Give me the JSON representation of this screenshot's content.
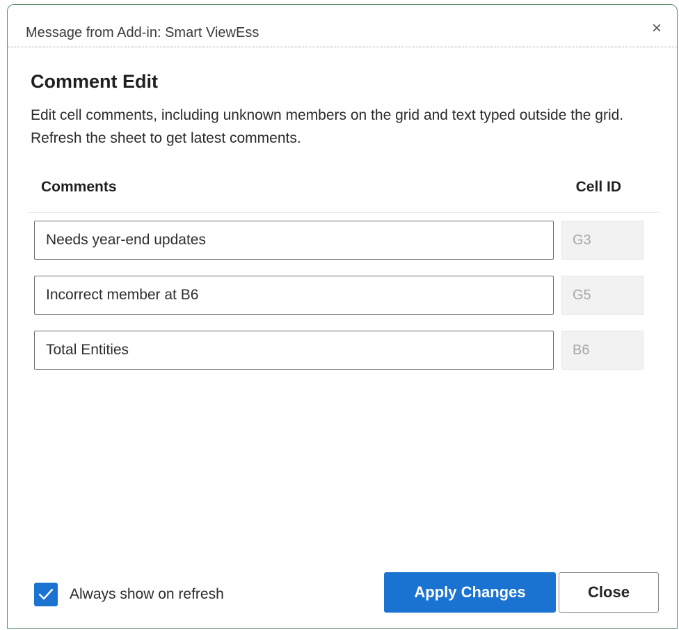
{
  "dialog": {
    "title": "Message from Add-in: Smart ViewEss",
    "close_glyph": "×"
  },
  "header": {
    "heading": "Comment Edit",
    "description": "Edit cell comments, including unknown members on the grid and text typed outside the grid. Refresh the sheet to get latest comments."
  },
  "table": {
    "col_comments": "Comments",
    "col_cell_id": "Cell ID",
    "rows": [
      {
        "comment": "Needs year-end updates",
        "cell_id": "G3"
      },
      {
        "comment": "Incorrect member at B6",
        "cell_id": "G5"
      },
      {
        "comment": "Total Entities",
        "cell_id": "B6"
      }
    ]
  },
  "footer": {
    "checkbox_label": "Always show on refresh",
    "checkbox_checked": true,
    "apply_label": "Apply Changes",
    "close_label": "Close"
  },
  "colors": {
    "accent": "#1a73d1",
    "window_border": "#5a8f6e"
  }
}
